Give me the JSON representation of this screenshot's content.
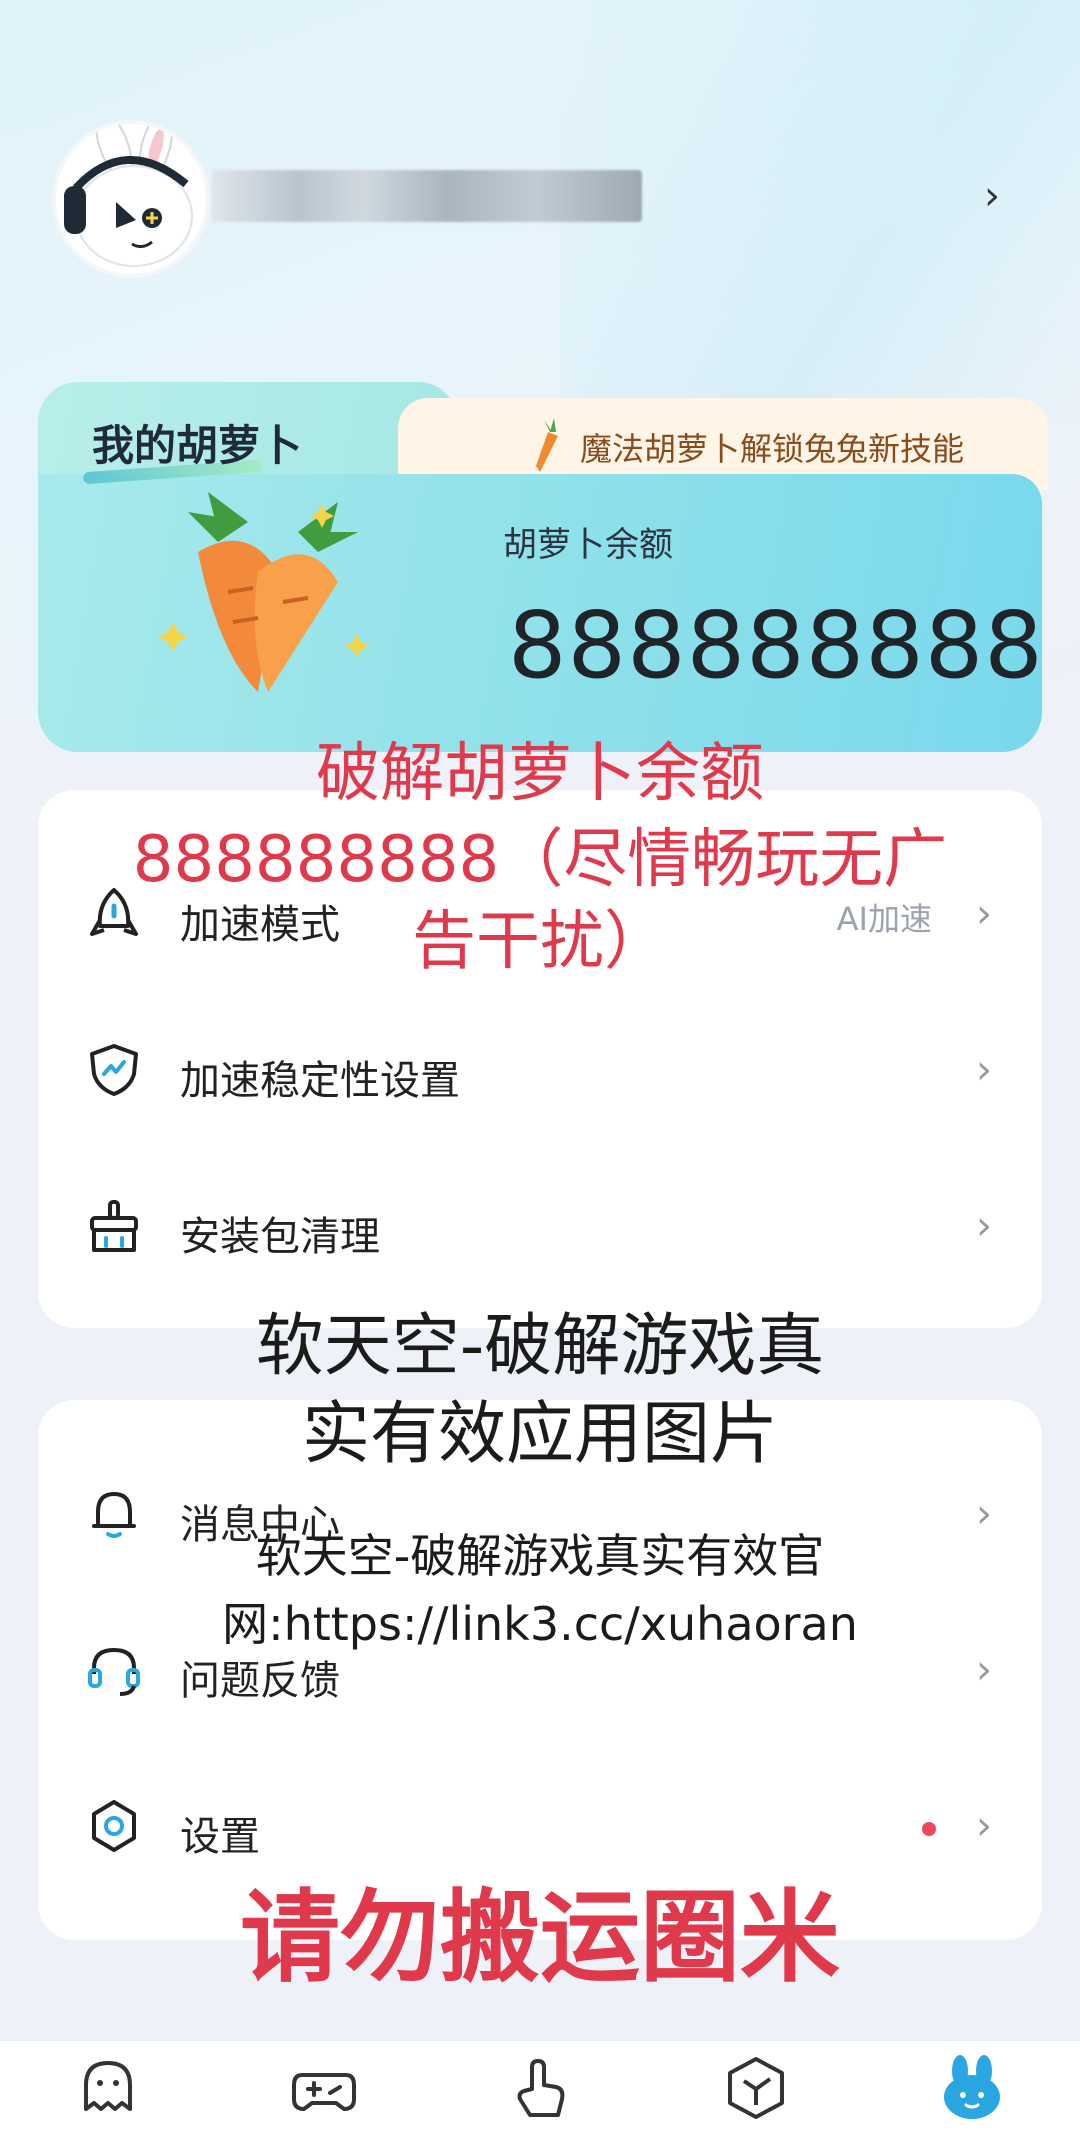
{
  "profile": {
    "chevron": "›"
  },
  "carrot": {
    "tab_title": "我的胡萝卜",
    "promo_text": "魔法胡萝卜解锁兔兔新技能",
    "balance_label": "胡萝卜余额",
    "balance_value": "888888888"
  },
  "settings_group_1": [
    {
      "label": "加速模式",
      "value": "AI加速",
      "icon": "rocket-icon"
    },
    {
      "label": "加速稳定性设置",
      "value": "",
      "icon": "shield-icon"
    },
    {
      "label": "安装包清理",
      "value": "",
      "icon": "broom-icon"
    }
  ],
  "settings_group_2": [
    {
      "label": "消息中心",
      "icon": "bell-icon"
    },
    {
      "label": "问题反馈",
      "icon": "headset-icon"
    },
    {
      "label": "设置",
      "icon": "gear-icon",
      "has_dot": true
    }
  ],
  "overlay": {
    "red_top_line1": "破解胡萝卜余额",
    "red_top_line2": "888888888（尽情畅玩无广",
    "red_top_line3": "告干扰）",
    "mid_line1": "软天空-破解游戏真",
    "mid_line2": "实有效应用图片",
    "site_line1": "软天空-破解游戏真实有效官",
    "site_line2": "网:https://link3.cc/xuhaoran",
    "bottom_red": "请勿搬运圈米"
  },
  "nav": [
    {
      "name": "home",
      "icon": "ghost-icon"
    },
    {
      "name": "games",
      "icon": "gamepad-icon"
    },
    {
      "name": "touch",
      "icon": "touch-icon"
    },
    {
      "name": "box",
      "icon": "cube-icon"
    },
    {
      "name": "me",
      "icon": "rabbit-icon",
      "active": true
    }
  ],
  "colors": {
    "accent": "#2aa7e0",
    "red_text": "#e0394b",
    "dot": "#f0475a"
  }
}
